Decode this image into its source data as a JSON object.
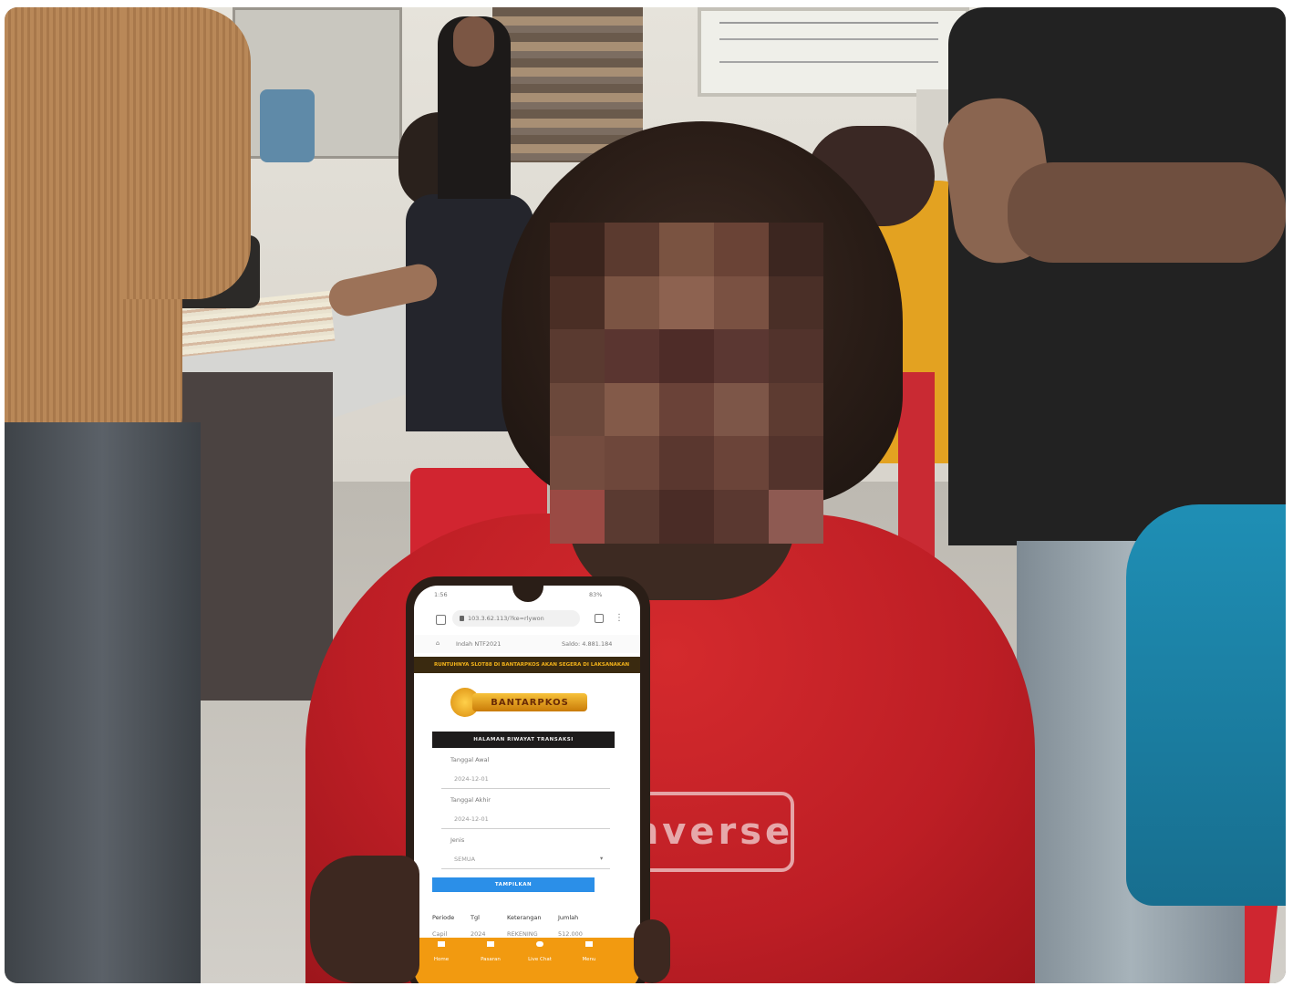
{
  "scene": {
    "description_hidden": "",
    "shirt_print": "nverse",
    "colors": {
      "wall": "#e4e1d9",
      "floor": "#c9c6bf",
      "shirt_red": "#c41f24",
      "phone_orange": "#f29a10",
      "brand_yellow": "#f2b21a",
      "button_blue": "#2b8fe8"
    }
  },
  "phone": {
    "status_time": "1:56",
    "status_right": "83%",
    "url": "103.3.62.113/?ke=rlywon",
    "subbar_left": "Indah NTF2021",
    "subbar_right": "Saldo: 4.881.184",
    "marquee": "RUNTUHNYA SLOT88 DI BANTARPKOS AKAN SEGERA DI LAKSANAKAN",
    "logo_text": "BANTARPKOS",
    "section_title": "HALAMAN RIWAYAT TRANSAKSI",
    "fields": [
      {
        "label": "Tanggal Awal",
        "value": "2024-12-01"
      },
      {
        "label": "Tanggal Akhir",
        "value": "2024-12-01"
      },
      {
        "label": "Jenis",
        "value": "SEMUA"
      }
    ],
    "button_label": "TAMPILKAN",
    "table_headers": [
      "Periode",
      "Tgl",
      "Keterangan",
      "Jumlah"
    ],
    "table_row": [
      "Capil",
      "2024",
      "REKENING",
      "512.000"
    ],
    "bottom_nav": [
      "Home",
      "Pasaran",
      "Live Chat",
      "Menu"
    ]
  }
}
